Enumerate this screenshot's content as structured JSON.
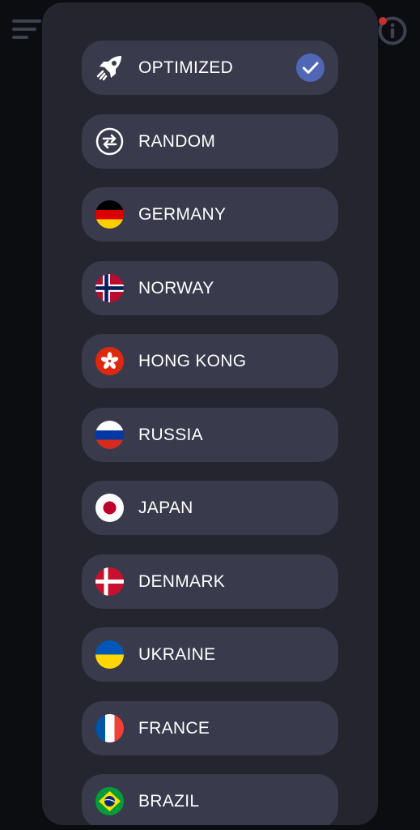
{
  "icons": {
    "menu": "hamburger-menu-icon",
    "info": "info-icon",
    "rocket": "rocket-icon",
    "random": "shuffle-icon",
    "check": "checkmark-icon"
  },
  "colors": {
    "background": "#0c0d10",
    "panel": "#24252f",
    "item": "#393b4c",
    "selected_check": "#4f67b5",
    "notification": "#c4302b"
  },
  "servers": [
    {
      "label": "OPTIMIZED",
      "selected": true
    },
    {
      "label": "RANDOM",
      "selected": false
    },
    {
      "label": "GERMANY",
      "selected": false
    },
    {
      "label": "NORWAY",
      "selected": false
    },
    {
      "label": "HONG KONG",
      "selected": false
    },
    {
      "label": "RUSSIA",
      "selected": false
    },
    {
      "label": "JAPAN",
      "selected": false
    },
    {
      "label": "DENMARK",
      "selected": false
    },
    {
      "label": "UKRAINE",
      "selected": false
    },
    {
      "label": "FRANCE",
      "selected": false
    },
    {
      "label": "BRAZIL",
      "selected": false
    }
  ]
}
